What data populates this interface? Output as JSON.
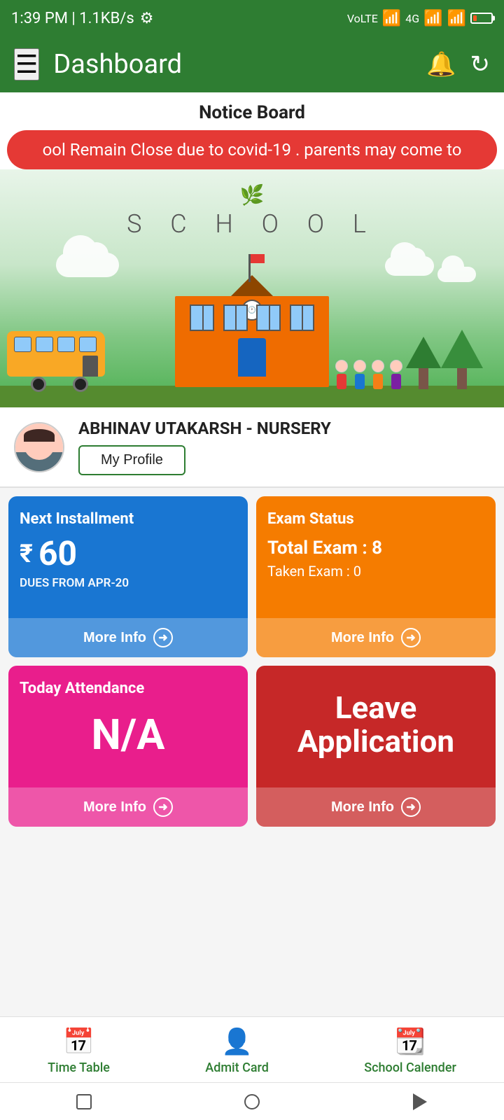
{
  "statusBar": {
    "time": "1:39 PM | 1.1KB/s",
    "settingsIcon": "gear-icon"
  },
  "header": {
    "menuIcon": "hamburger-icon",
    "title": "Dashboard",
    "notificationIcon": "bell-icon",
    "refreshIcon": "refresh-icon"
  },
  "noticeboard": {
    "title": "Notice Board",
    "tickerText": "ool Remain Close due to covid-19 . parents may come to"
  },
  "schoolImage": {
    "leafIcon": "🌿",
    "label": "S C H O O L"
  },
  "profile": {
    "name": "ABHINAV UTAKARSH - NURSERY",
    "profileBtnLabel": "My Profile"
  },
  "cards": {
    "installment": {
      "title": "Next Installment",
      "amount": "60",
      "subtitle": "DUES FROM APR-20",
      "moreInfo": "More Info"
    },
    "examStatus": {
      "title": "Exam Status",
      "totalExam": "Total Exam : 8",
      "takenExam": "Taken Exam : 0",
      "moreInfo": "More Info"
    },
    "attendance": {
      "title": "Today Attendance",
      "value": "N/A",
      "moreInfo": "More Info"
    },
    "leaveApplication": {
      "title": "Leave",
      "subtitle": "Application",
      "moreInfo": "More Info"
    }
  },
  "bottomNav": {
    "items": [
      {
        "label": "Time Table",
        "icon": "📅"
      },
      {
        "label": "Admit Card",
        "icon": "👤"
      },
      {
        "label": "School Calender",
        "icon": "📆"
      }
    ]
  },
  "sysNav": {
    "squareIcon": "square-icon",
    "circleIcon": "circle-icon",
    "triangleIcon": "back-icon"
  }
}
